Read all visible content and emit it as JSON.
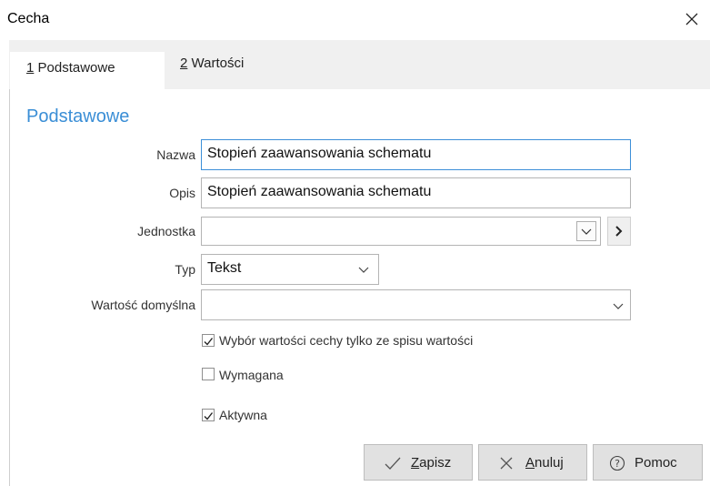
{
  "window": {
    "title": "Cecha"
  },
  "tabs": [
    {
      "num": "1",
      "label": " Podstawowe",
      "active": true
    },
    {
      "num": "2",
      "label": " Wartości",
      "active": false
    }
  ],
  "section": {
    "title": "Podstawowe"
  },
  "form": {
    "nazwa": {
      "label": "Nazwa",
      "value": "Stopień zaawansowania schematu"
    },
    "opis": {
      "label": "Opis",
      "value": "Stopień zaawansowania schematu"
    },
    "jednostka": {
      "label": "Jednostka",
      "value": ""
    },
    "typ": {
      "label": "Typ",
      "value": "Tekst"
    },
    "wartosc_domyslna": {
      "label": "Wartość domyślna",
      "value": ""
    }
  },
  "checkboxes": [
    {
      "label": "Wybór wartości cechy tylko ze spisu wartości",
      "checked": true
    },
    {
      "label": "Wymagana",
      "checked": false
    },
    {
      "label": "Aktywna",
      "checked": true
    }
  ],
  "buttons": {
    "save": {
      "mnemonic": "Z",
      "rest": "apisz"
    },
    "cancel": {
      "mnemonic": "A",
      "rest": "nuluj"
    },
    "help": {
      "label": "Pomoc"
    }
  },
  "colors": {
    "accent": "#3a8ed6",
    "focus_border": "#3c8fd8",
    "button_bg": "#e1e1e1",
    "tabstrip_bg": "#f0f0f0"
  }
}
